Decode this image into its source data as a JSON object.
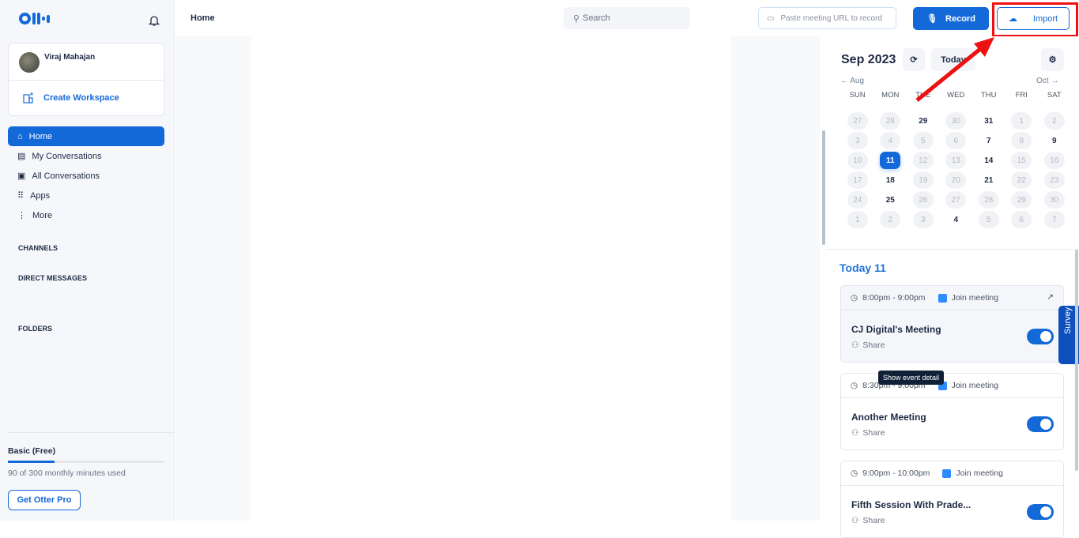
{
  "sidebar": {
    "user_name": "Viraj Mahajan",
    "create_workspace": "Create Workspace",
    "nav": [
      {
        "label": "Home",
        "icon": "home-icon",
        "active": true
      },
      {
        "label": "My Conversations",
        "icon": "document-icon"
      },
      {
        "label": "All Conversations",
        "icon": "conversations-icon"
      },
      {
        "label": "Apps",
        "icon": "grid-icon"
      },
      {
        "label": "More",
        "icon": "more-vertical-icon"
      }
    ],
    "sections": {
      "channels": "CHANNELS",
      "direct_messages": "DIRECT MESSAGES",
      "folders": "FOLDERS"
    },
    "plan": {
      "name": "Basic (Free)",
      "usage_text": "90 of 300 monthly minutes used",
      "used_minutes": 90,
      "total_minutes": 300,
      "upgrade_label": "Get Otter Pro"
    }
  },
  "header": {
    "title": "Home",
    "search_placeholder": "Search",
    "url_placeholder": "Paste meeting URL to record",
    "record_label": "Record",
    "import_label": "Import"
  },
  "calendar": {
    "month_label": "Sep 2023",
    "today_label": "Today",
    "prev_label": "Aug",
    "next_label": "Oct",
    "weekdays": [
      "SUN",
      "MON",
      "TUE",
      "WED",
      "THU",
      "FRI",
      "SAT"
    ],
    "weeks": [
      [
        [
          "27",
          "muted"
        ],
        [
          "28",
          "muted"
        ],
        [
          "29",
          "bold"
        ],
        [
          "30",
          "muted"
        ],
        [
          "31",
          "bold"
        ],
        [
          "1",
          "muted"
        ],
        [
          "2",
          "muted"
        ]
      ],
      [
        [
          "3",
          "muted"
        ],
        [
          "4",
          "muted"
        ],
        [
          "5",
          "muted"
        ],
        [
          "6",
          "muted"
        ],
        [
          "7",
          "bold"
        ],
        [
          "8",
          "muted"
        ],
        [
          "9",
          "bold"
        ]
      ],
      [
        [
          "10",
          "muted"
        ],
        [
          "11",
          "selected"
        ],
        [
          "12",
          "muted"
        ],
        [
          "13",
          "muted"
        ],
        [
          "14",
          "bold"
        ],
        [
          "15",
          "muted"
        ],
        [
          "16",
          "muted"
        ]
      ],
      [
        [
          "17",
          "muted"
        ],
        [
          "18",
          "bold"
        ],
        [
          "19",
          "muted"
        ],
        [
          "20",
          "muted"
        ],
        [
          "21",
          "bold"
        ],
        [
          "22",
          "muted"
        ],
        [
          "23",
          "muted"
        ]
      ],
      [
        [
          "24",
          "muted"
        ],
        [
          "25",
          "bold"
        ],
        [
          "26",
          "muted"
        ],
        [
          "27",
          "muted"
        ],
        [
          "28",
          "muted"
        ],
        [
          "29",
          "muted"
        ],
        [
          "30",
          "muted"
        ]
      ],
      [
        [
          "1",
          "muted"
        ],
        [
          "2",
          "muted"
        ],
        [
          "3",
          "muted"
        ],
        [
          "4",
          "bold"
        ],
        [
          "5",
          "muted"
        ],
        [
          "6",
          "muted"
        ],
        [
          "7",
          "muted"
        ]
      ]
    ]
  },
  "events": {
    "heading": "Today 11",
    "items": [
      {
        "time": "8:00pm - 9:00pm",
        "join": "Join meeting",
        "title": "CJ Digital's Meeting",
        "share": "Share",
        "record_enabled": true
      },
      {
        "time": "8:30pm - 9:00pm",
        "join": "Join meeting",
        "title": "Another Meeting",
        "share": "Share",
        "record_enabled": true
      },
      {
        "time": "9:00pm - 10:00pm",
        "join": "Join meeting",
        "title": "Fifth Session With Prade...",
        "share": "Share",
        "record_enabled": true
      }
    ],
    "tooltip": "Show event detail"
  },
  "survey_label": "Survey",
  "colors": {
    "accent": "#1469d9",
    "highlight_annotation": "#ee1111"
  }
}
